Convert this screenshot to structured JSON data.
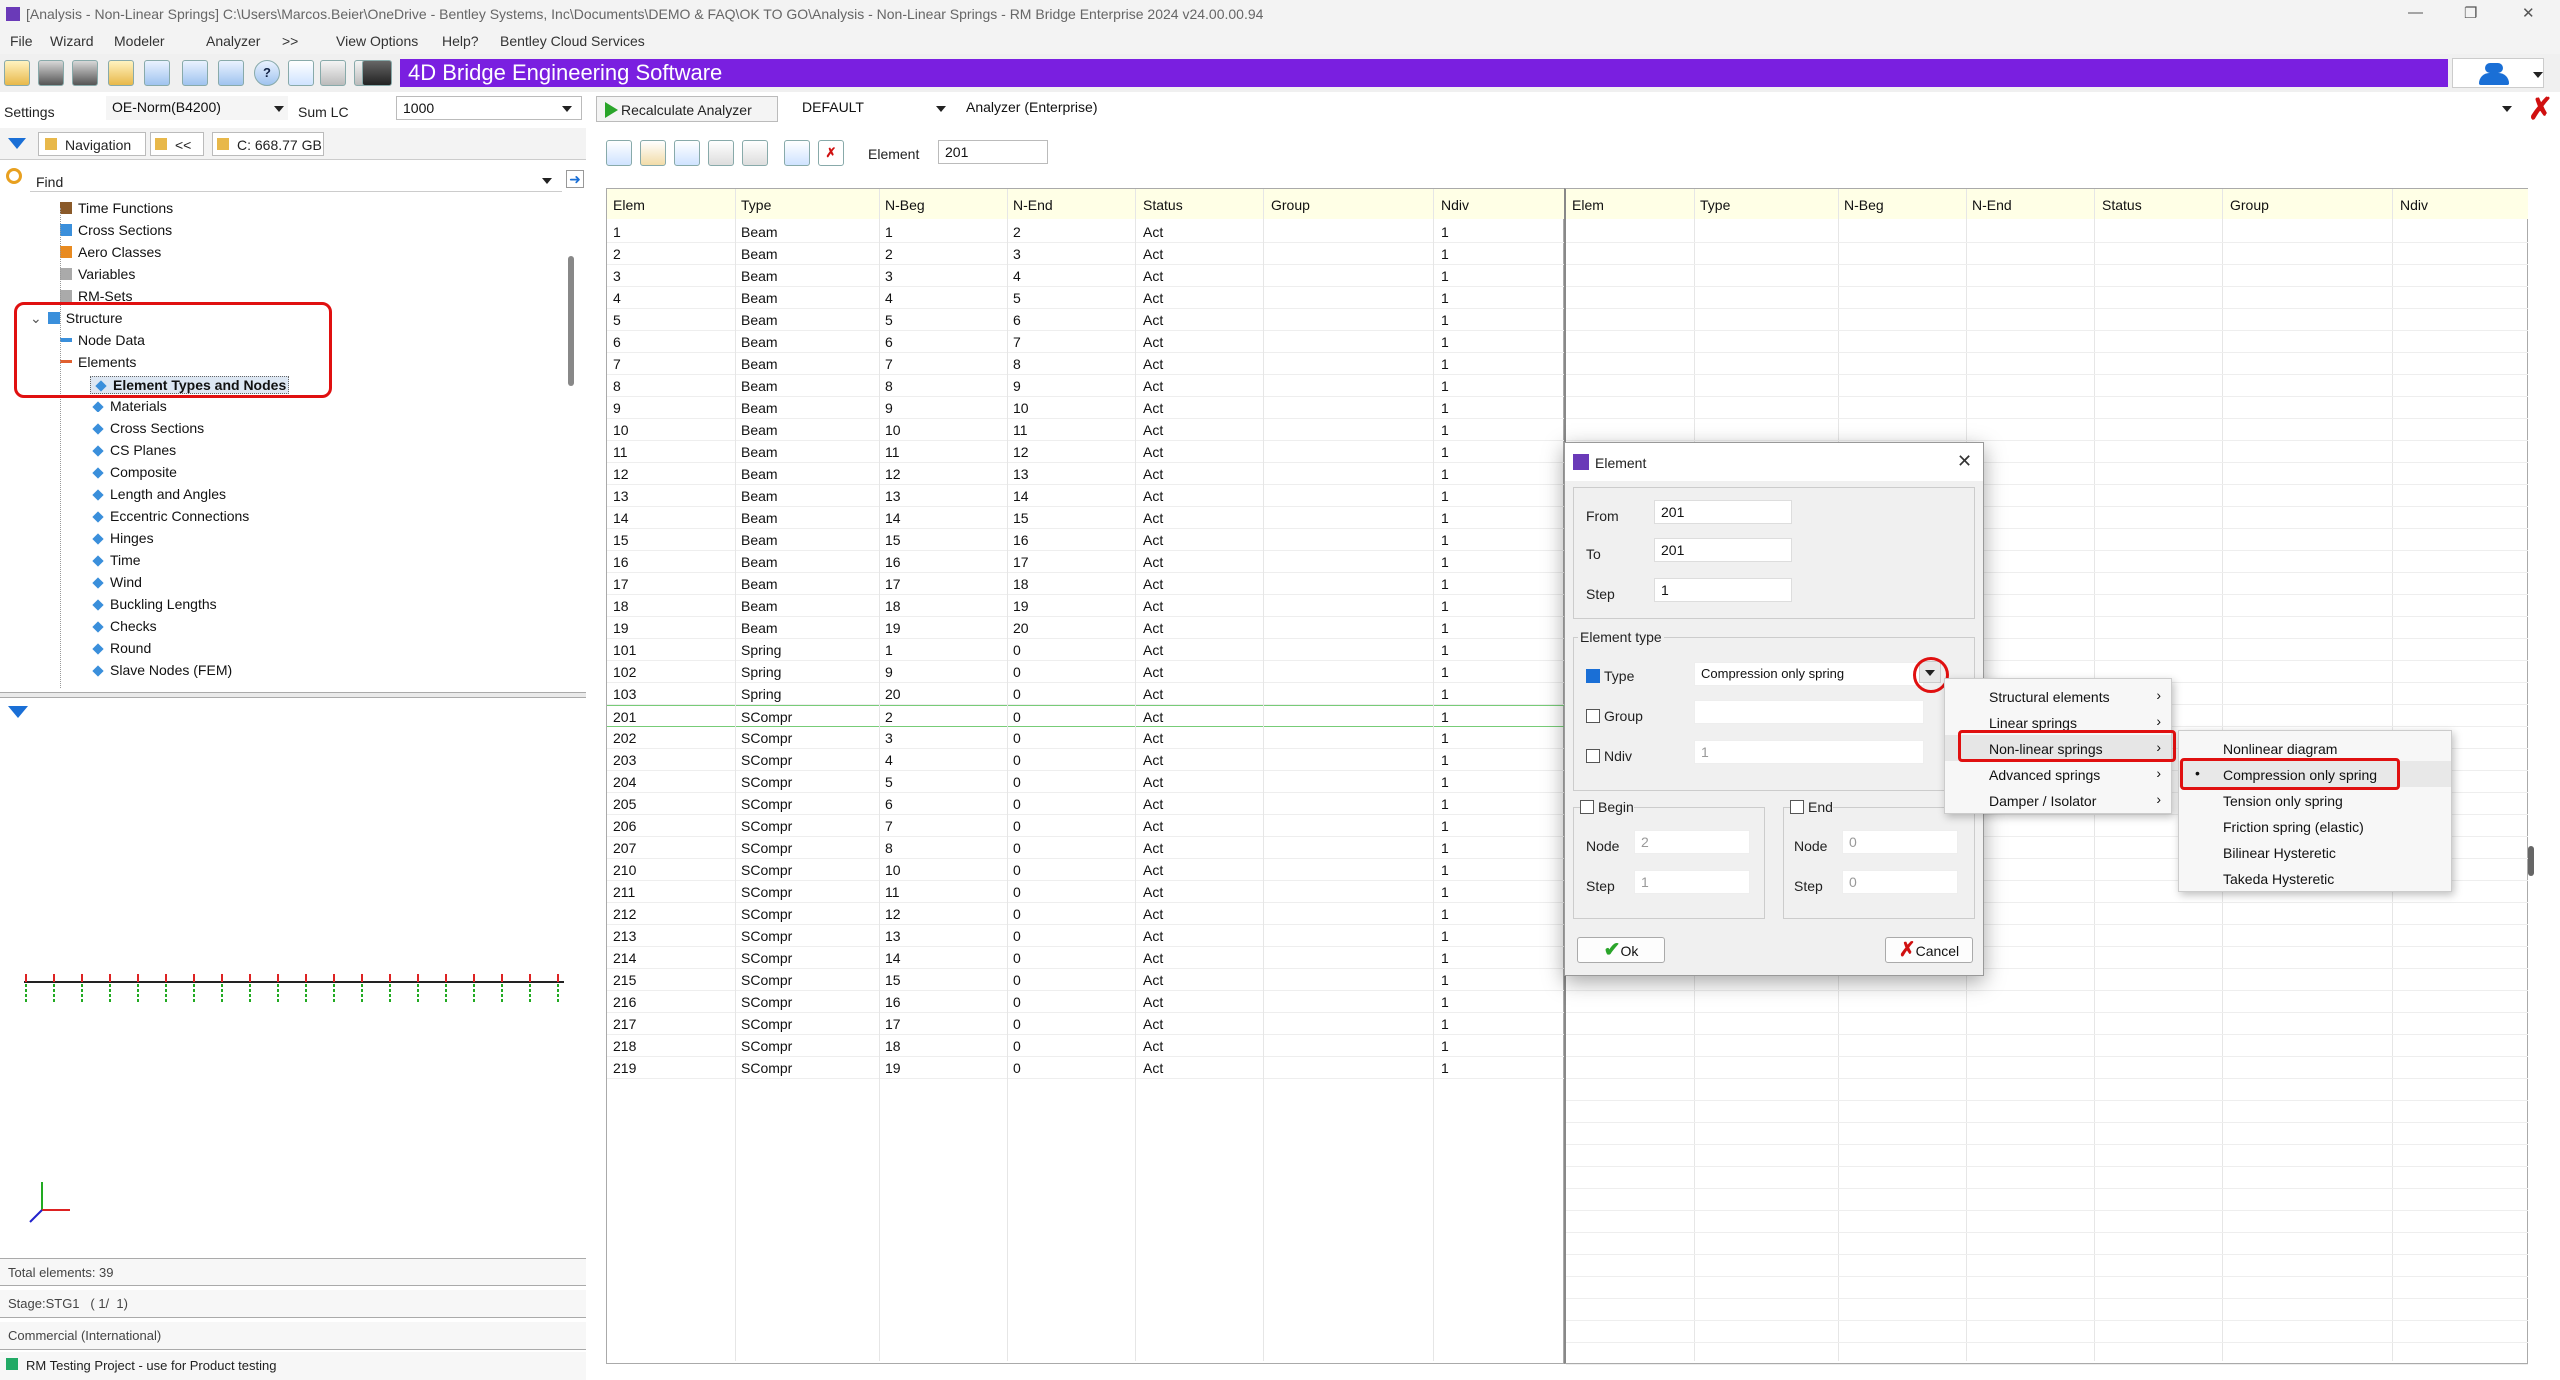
{
  "window": {
    "title": "[Analysis - Non-Linear Springs] C:\\Users\\Marcos.Beier\\OneDrive - Bentley Systems, Inc\\Documents\\DEMO & FAQ\\OK TO GO\\Analysis - Non-Linear Springs - RM Bridge Enterprise 2024 v24.00.00.94"
  },
  "menu": [
    "File",
    "Wizard",
    "Modeler",
    "Analyzer",
    ">>",
    "View Options",
    "Help?",
    "Bentley Cloud Services"
  ],
  "banner": "4D Bridge Engineering Software",
  "settings": {
    "label": "Settings",
    "norm": "OE-Norm(B4200)",
    "sumlc_label": "Sum LC",
    "sumlc_value": "1000"
  },
  "analyzer_bar": {
    "recalc": "Recalculate Analyzer",
    "preset": "DEFAULT",
    "mode": "Analyzer (Enterprise)"
  },
  "nav": {
    "label": "Navigation",
    "back": "<<",
    "disk": "C: 668.77 GB",
    "find": "Find"
  },
  "tree": [
    {
      "label": "Time Functions"
    },
    {
      "label": "Cross Sections"
    },
    {
      "label": "Aero Classes"
    },
    {
      "label": "Variables"
    },
    {
      "label": "RM-Sets"
    },
    {
      "label": "Structure"
    },
    {
      "label": "Node Data"
    },
    {
      "label": "Elements"
    },
    {
      "label": "Element Types and Nodes"
    },
    {
      "label": "Materials"
    },
    {
      "label": "Cross Sections"
    },
    {
      "label": "CS Planes"
    },
    {
      "label": "Composite"
    },
    {
      "label": "Length and Angles"
    },
    {
      "label": "Eccentric Connections"
    },
    {
      "label": "Hinges"
    },
    {
      "label": "Time"
    },
    {
      "label": "Wind"
    },
    {
      "label": "Buckling Lengths"
    },
    {
      "label": "Checks"
    },
    {
      "label": "Round"
    },
    {
      "label": "Slave Nodes (FEM)"
    }
  ],
  "status": {
    "total": "Total elements: 39",
    "stage": "Stage:STG1   ( 1/  1)",
    "license": "Commercial (International)",
    "project": "RM Testing Project - use for Product testing"
  },
  "element_field": {
    "label": "Element",
    "value": "201"
  },
  "table": {
    "headers": [
      "Elem",
      "Type",
      "N-Beg",
      "N-End",
      "Status",
      "Group",
      "Ndiv"
    ],
    "rows": [
      [
        "1",
        "Beam",
        "1",
        "2",
        "Act",
        "",
        "1"
      ],
      [
        "2",
        "Beam",
        "2",
        "3",
        "Act",
        "",
        "1"
      ],
      [
        "3",
        "Beam",
        "3",
        "4",
        "Act",
        "",
        "1"
      ],
      [
        "4",
        "Beam",
        "4",
        "5",
        "Act",
        "",
        "1"
      ],
      [
        "5",
        "Beam",
        "5",
        "6",
        "Act",
        "",
        "1"
      ],
      [
        "6",
        "Beam",
        "6",
        "7",
        "Act",
        "",
        "1"
      ],
      [
        "7",
        "Beam",
        "7",
        "8",
        "Act",
        "",
        "1"
      ],
      [
        "8",
        "Beam",
        "8",
        "9",
        "Act",
        "",
        "1"
      ],
      [
        "9",
        "Beam",
        "9",
        "10",
        "Act",
        "",
        "1"
      ],
      [
        "10",
        "Beam",
        "10",
        "11",
        "Act",
        "",
        "1"
      ],
      [
        "11",
        "Beam",
        "11",
        "12",
        "Act",
        "",
        "1"
      ],
      [
        "12",
        "Beam",
        "12",
        "13",
        "Act",
        "",
        "1"
      ],
      [
        "13",
        "Beam",
        "13",
        "14",
        "Act",
        "",
        "1"
      ],
      [
        "14",
        "Beam",
        "14",
        "15",
        "Act",
        "",
        "1"
      ],
      [
        "15",
        "Beam",
        "15",
        "16",
        "Act",
        "",
        "1"
      ],
      [
        "16",
        "Beam",
        "16",
        "17",
        "Act",
        "",
        "1"
      ],
      [
        "17",
        "Beam",
        "17",
        "18",
        "Act",
        "",
        "1"
      ],
      [
        "18",
        "Beam",
        "18",
        "19",
        "Act",
        "",
        "1"
      ],
      [
        "19",
        "Beam",
        "19",
        "20",
        "Act",
        "",
        "1"
      ],
      [
        "101",
        "Spring",
        "1",
        "0",
        "Act",
        "",
        "1"
      ],
      [
        "102",
        "Spring",
        "9",
        "0",
        "Act",
        "",
        "1"
      ],
      [
        "103",
        "Spring",
        "20",
        "0",
        "Act",
        "",
        "1"
      ],
      [
        "201",
        "SCompr",
        "2",
        "0",
        "Act",
        "",
        "1"
      ],
      [
        "202",
        "SCompr",
        "3",
        "0",
        "Act",
        "",
        "1"
      ],
      [
        "203",
        "SCompr",
        "4",
        "0",
        "Act",
        "",
        "1"
      ],
      [
        "204",
        "SCompr",
        "5",
        "0",
        "Act",
        "",
        "1"
      ],
      [
        "205",
        "SCompr",
        "6",
        "0",
        "Act",
        "",
        "1"
      ],
      [
        "206",
        "SCompr",
        "7",
        "0",
        "Act",
        "",
        "1"
      ],
      [
        "207",
        "SCompr",
        "8",
        "0",
        "Act",
        "",
        "1"
      ],
      [
        "210",
        "SCompr",
        "10",
        "0",
        "Act",
        "",
        "1"
      ],
      [
        "211",
        "SCompr",
        "11",
        "0",
        "Act",
        "",
        "1"
      ],
      [
        "212",
        "SCompr",
        "12",
        "0",
        "Act",
        "",
        "1"
      ],
      [
        "213",
        "SCompr",
        "13",
        "0",
        "Act",
        "",
        "1"
      ],
      [
        "214",
        "SCompr",
        "14",
        "0",
        "Act",
        "",
        "1"
      ],
      [
        "215",
        "SCompr",
        "15",
        "0",
        "Act",
        "",
        "1"
      ],
      [
        "216",
        "SCompr",
        "16",
        "0",
        "Act",
        "",
        "1"
      ],
      [
        "217",
        "SCompr",
        "17",
        "0",
        "Act",
        "",
        "1"
      ],
      [
        "218",
        "SCompr",
        "18",
        "0",
        "Act",
        "",
        "1"
      ],
      [
        "219",
        "SCompr",
        "19",
        "0",
        "Act",
        "",
        "1"
      ]
    ]
  },
  "dialog": {
    "title": "Element",
    "from_label": "From",
    "from_value": "201",
    "to_label": "To",
    "to_value": "201",
    "step_label": "Step",
    "step_value": "1",
    "element_type_label": "Element type",
    "type_label": "Type",
    "type_value": "Compression only spring",
    "group_label": "Group",
    "ndiv_label": "Ndiv",
    "ndiv_value": "1",
    "begin_label": "Begin",
    "begin_node_label": "Node",
    "begin_node_value": "2",
    "begin_step_label": "Step",
    "begin_step_value": "1",
    "end_label": "End",
    "end_node_label": "Node",
    "end_node_value": "0",
    "end_step_label": "Step",
    "end_step_value": "0",
    "ok": "Ok",
    "cancel": "Cancel"
  },
  "type_menu": [
    "Structural elements",
    "Linear springs",
    "Non-linear springs",
    "Advanced springs",
    "Damper / Isolator"
  ],
  "nonlinear_menu": [
    "Nonlinear diagram",
    "Compression only spring",
    "Tension only spring",
    "Friction spring (elastic)",
    "Bilinear Hysteretic",
    "Takeda Hysteretic"
  ],
  "colors": {
    "banner": "#7a1fe0",
    "highlight_box": "#e01010",
    "checkbox": "#1a6fd6"
  }
}
